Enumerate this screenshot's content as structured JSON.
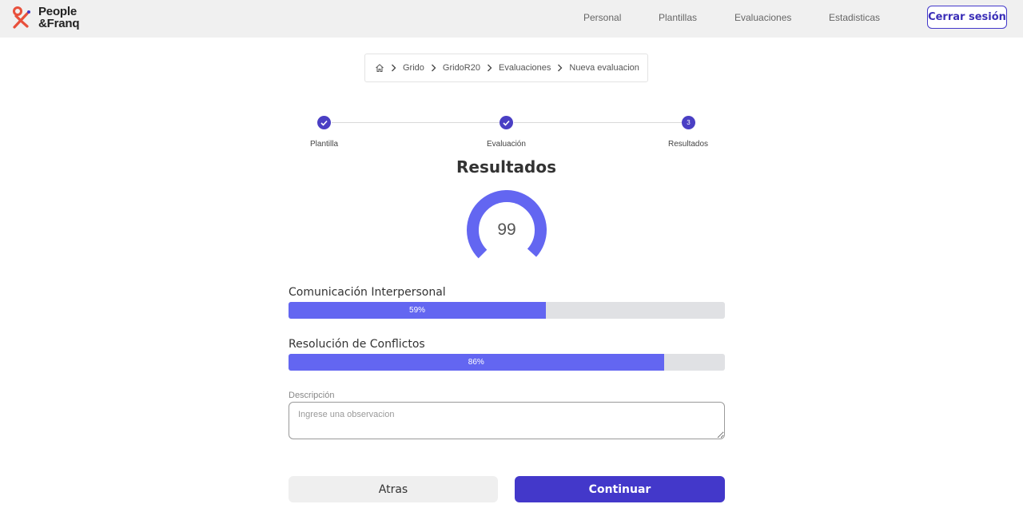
{
  "brand": {
    "line1": "People",
    "line2": "&Franq",
    "accent_color": "#e8503c",
    "logo_icon": "people-franq-logo-icon"
  },
  "nav": {
    "links": [
      "Personal",
      "Plantillas",
      "Evaluaciones",
      "Estadisticas"
    ],
    "logout_label": "Cerrar sesión"
  },
  "breadcrumb": {
    "home_icon": "home-icon",
    "items": [
      "Grido",
      "GridoR20",
      "Evaluaciones",
      "Nueva evaluacion"
    ]
  },
  "stepper": {
    "steps": [
      {
        "label": "Plantilla",
        "state": "done"
      },
      {
        "label": "Evaluación",
        "state": "done"
      },
      {
        "label": "Resultados",
        "state": "current",
        "number": "3"
      }
    ]
  },
  "results": {
    "title": "Resultados",
    "score": "99",
    "score_value": 99,
    "primary_color": "#6366f1"
  },
  "bars": [
    {
      "label": "Comunicación Interpersonal",
      "percent_text": "59%",
      "value": 0.59
    },
    {
      "label": "Resolución de Conflictos",
      "percent_text": "86%",
      "value": 0.86
    }
  ],
  "description": {
    "label": "Descripción",
    "placeholder": "Ingrese una observacion",
    "value": ""
  },
  "actions": {
    "back_label": "Atras",
    "continue_label": "Continuar"
  }
}
